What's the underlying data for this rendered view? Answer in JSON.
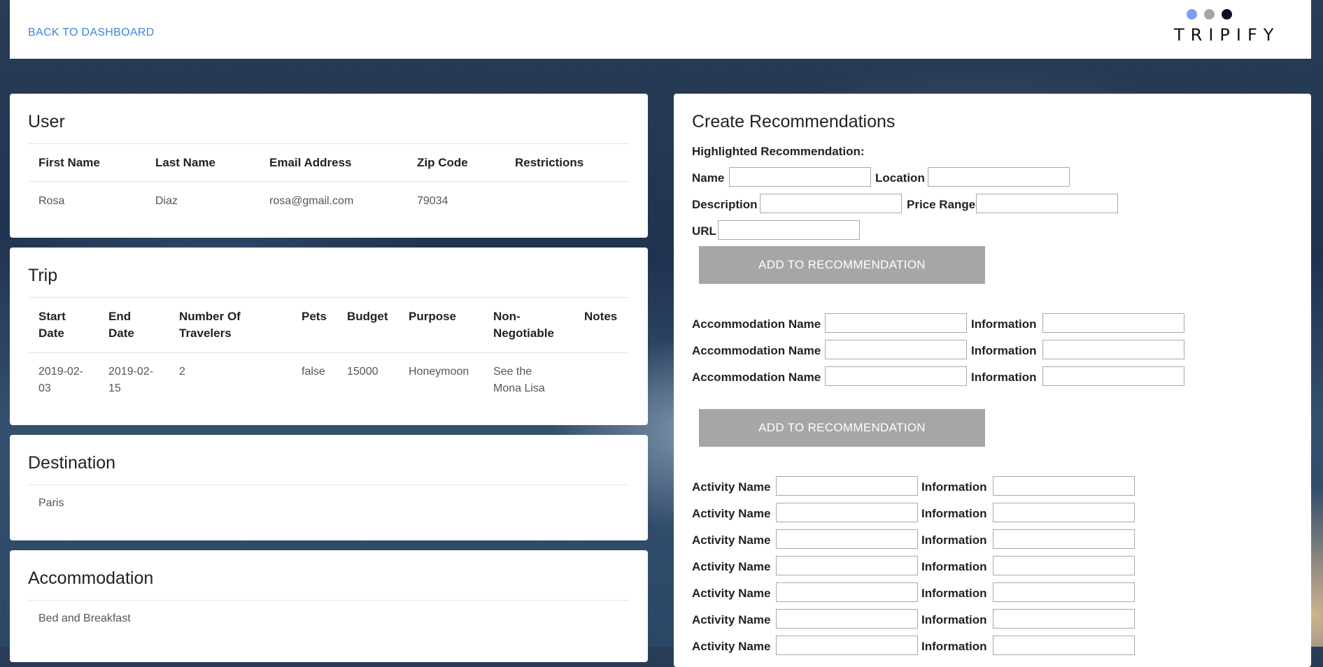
{
  "nav": {
    "back_label": "BACK TO DASHBOARD"
  },
  "logo": {
    "text": "TRIPIFY",
    "dot_colors": [
      "#7b9ef0",
      "#a6a6a6",
      "#0d0d24"
    ]
  },
  "user": {
    "title": "User",
    "headers": [
      "First Name",
      "Last Name",
      "Email Address",
      "Zip Code",
      "Restrictions"
    ],
    "values": [
      "Rosa",
      "Diaz",
      "rosa@gmail.com",
      "79034",
      ""
    ]
  },
  "trip": {
    "title": "Trip",
    "headers": [
      "Start Date",
      "End Date",
      "Number Of Travelers",
      "Pets",
      "Budget",
      "Purpose",
      "Non-Negotiable",
      "Notes"
    ],
    "header_lines": [
      [
        "Start",
        "Date"
      ],
      [
        "End",
        "Date"
      ],
      [
        "Number Of",
        "Travelers"
      ],
      [
        "Pets"
      ],
      [
        "Budget"
      ],
      [
        "Purpose"
      ],
      [
        "Non-",
        "Negotiable"
      ],
      [
        "Notes"
      ]
    ],
    "values": [
      "2019-02-03",
      "2019-02-15",
      "2",
      "false",
      "15000",
      "Honeymoon",
      "See the Mona Lisa",
      ""
    ],
    "value_lines": [
      [
        "2019-02-",
        "03"
      ],
      [
        "2019-02-",
        "15"
      ],
      [
        "2"
      ],
      [
        "false"
      ],
      [
        "15000"
      ],
      [
        "Honeymoon"
      ],
      [
        "See the",
        "Mona Lisa"
      ],
      [
        ""
      ]
    ]
  },
  "destination": {
    "title": "Destination",
    "value": "Paris"
  },
  "accommodation": {
    "title": "Accommodation",
    "value": "Bed and Breakfast"
  },
  "create": {
    "title": "Create Recommendations",
    "highlighted_label": "Highlighted Recommendation:",
    "name_label": "Name",
    "location_label": "Location",
    "description_label": "Description",
    "price_range_label": "Price Range",
    "url_label": "URL",
    "add_button_label": "ADD TO RECOMMENDATION",
    "accommodation_label": "Accommodation Name",
    "information_label": "Information",
    "activity_label": "Activity Name",
    "accommodation_rows": 3,
    "activity_rows": 7
  }
}
